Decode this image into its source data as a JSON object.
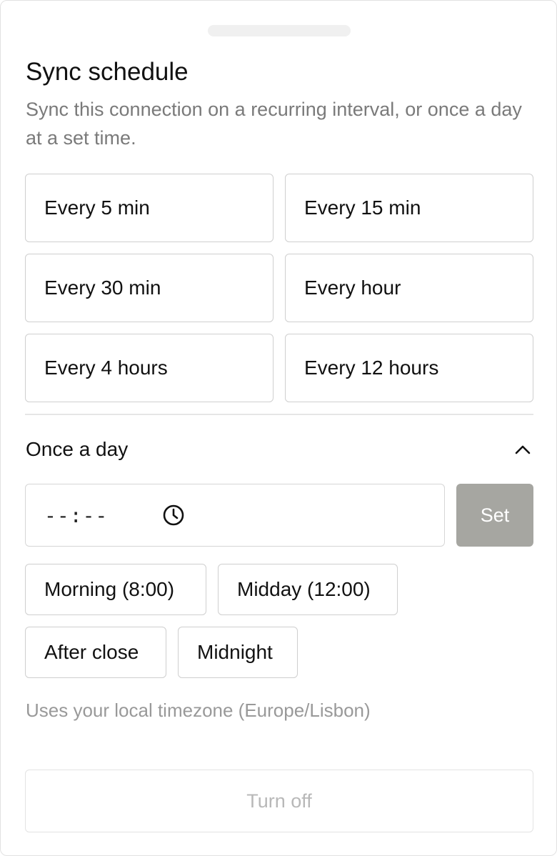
{
  "header": {
    "title": "Sync schedule",
    "subtitle": "Sync this connection on a recurring interval, or once a day at a set time."
  },
  "intervals": [
    {
      "label": "Every 5 min"
    },
    {
      "label": "Every 15 min"
    },
    {
      "label": "Every 30 min"
    },
    {
      "label": "Every hour"
    },
    {
      "label": "Every 4 hours"
    },
    {
      "label": "Every 12 hours"
    }
  ],
  "daily": {
    "title": "Once a day",
    "expanded": true,
    "time_value": "--:--",
    "set_label": "Set",
    "presets": [
      {
        "label": "Morning (8:00)"
      },
      {
        "label": "Midday (12:00)"
      },
      {
        "label": "After close"
      },
      {
        "label": "Midnight"
      }
    ],
    "timezone_hint": "Uses your local timezone (Europe/Lisbon)"
  },
  "footer": {
    "turn_off_label": "Turn off"
  },
  "colors": {
    "set_button_bg": "#a6a6a1",
    "border": "#cfcfcf",
    "muted_text": "#7a7a7a"
  },
  "icons": {
    "section_toggle": "chevron-up-icon",
    "time_picker": "clock-icon"
  }
}
